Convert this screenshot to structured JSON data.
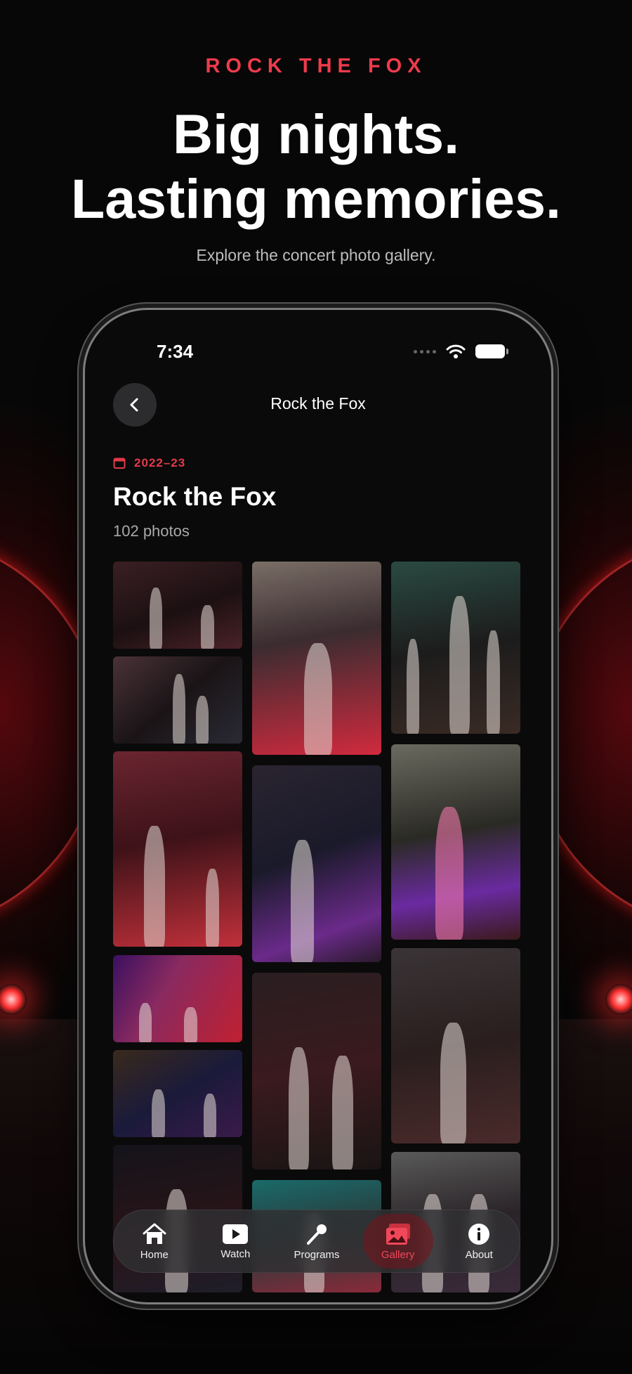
{
  "hero": {
    "eyebrow": "ROCK THE FOX",
    "headline_line1": "Big nights.",
    "headline_line2": "Lasting memories.",
    "subline": "Explore the concert photo gallery."
  },
  "status_bar": {
    "time": "7:34"
  },
  "nav": {
    "title": "Rock the Fox",
    "back_icon": "chevron-left-icon"
  },
  "header": {
    "season": "2022–23",
    "title": "Rock the Fox",
    "photo_count": "102 photos"
  },
  "tabs": [
    {
      "label": "Home",
      "icon": "home-icon",
      "active": false
    },
    {
      "label": "Watch",
      "icon": "play-icon",
      "active": false
    },
    {
      "label": "Programs",
      "icon": "microphone-icon",
      "active": false
    },
    {
      "label": "Gallery",
      "icon": "photos-icon",
      "active": true
    },
    {
      "label": "About",
      "icon": "info-icon",
      "active": false
    }
  ],
  "colors": {
    "accent": "#e23a48",
    "background": "#0a0a0a",
    "tab_active": "#f0485a"
  }
}
